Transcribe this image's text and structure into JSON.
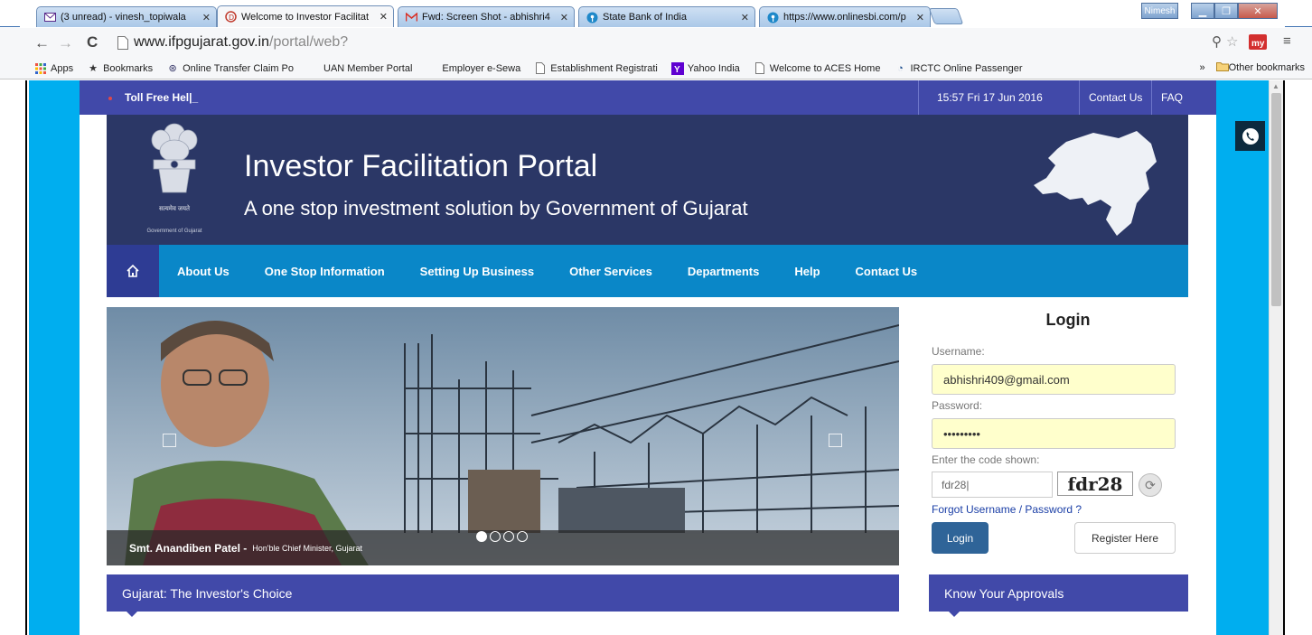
{
  "browser": {
    "tabs": [
      {
        "label": "(3 unread) - vinesh_topiwala",
        "icon": "mail-icon"
      },
      {
        "label": "Welcome to Investor Facilitat",
        "icon": "site-icon",
        "active": true
      },
      {
        "label": "Fwd: Screen Shot - abhishri4",
        "icon": "gmail-icon"
      },
      {
        "label": "State Bank of India",
        "icon": "sbi-icon"
      },
      {
        "label": "https://www.onlinesbi.com/p",
        "icon": "sbi-icon"
      }
    ],
    "user_label": "Nimesh",
    "url_host": "www.ifpgujarat.gov.in",
    "url_path": "/portal/web?",
    "bookmarks": [
      "Apps",
      "Bookmarks",
      "Online Transfer Claim Po",
      "UAN Member Portal",
      "Employer e-Sewa",
      "Establishment Registrati",
      "Yahoo India",
      "Welcome to ACES Home",
      "IRCTC Online Passenger"
    ],
    "other_bookmarks": "Other bookmarks",
    "chevron": "»"
  },
  "site": {
    "toll_free": "Toll Free Hel|_",
    "datetime": "15:57  Fri  17 Jun 2016",
    "contact_us": "Contact Us",
    "faq": "FAQ",
    "emblem_caption": "Government of Gujarat",
    "emblem_script": "सत्यमेव जयते",
    "title": "Investor Facilitation Portal",
    "tagline": "A one stop investment solution by Government of Gujarat",
    "nav": [
      "About Us",
      "One Stop Information",
      "Setting Up Business",
      "Other Services",
      "Departments",
      "Help",
      "Contact Us"
    ],
    "slider": {
      "caption_name": "Smt. Anandiben Patel -",
      "caption_role": "Hon'ble Chief Minister, Gujarat",
      "slide_count": 4,
      "active_slide": 1
    },
    "login": {
      "heading": "Login",
      "username_label": "Username:",
      "username_value": "abhishri409@gmail.com",
      "password_label": "Password:",
      "password_value": "•••••••••",
      "captcha_label": "Enter the code shown:",
      "captcha_input": "fdr28|",
      "captcha_image": "fdr28",
      "forgot": "Forgot Username / Password ?",
      "login_button": "Login",
      "register_button": "Register Here"
    },
    "sections": {
      "left": "Gujarat: The Investor's Choice",
      "right": "Know Your Approvals"
    }
  },
  "colors": {
    "accent_blue": "#4149a9",
    "nav_blue": "#0a87c8",
    "banner_navy": "#2b3766",
    "page_cyan": "#00aeef"
  }
}
